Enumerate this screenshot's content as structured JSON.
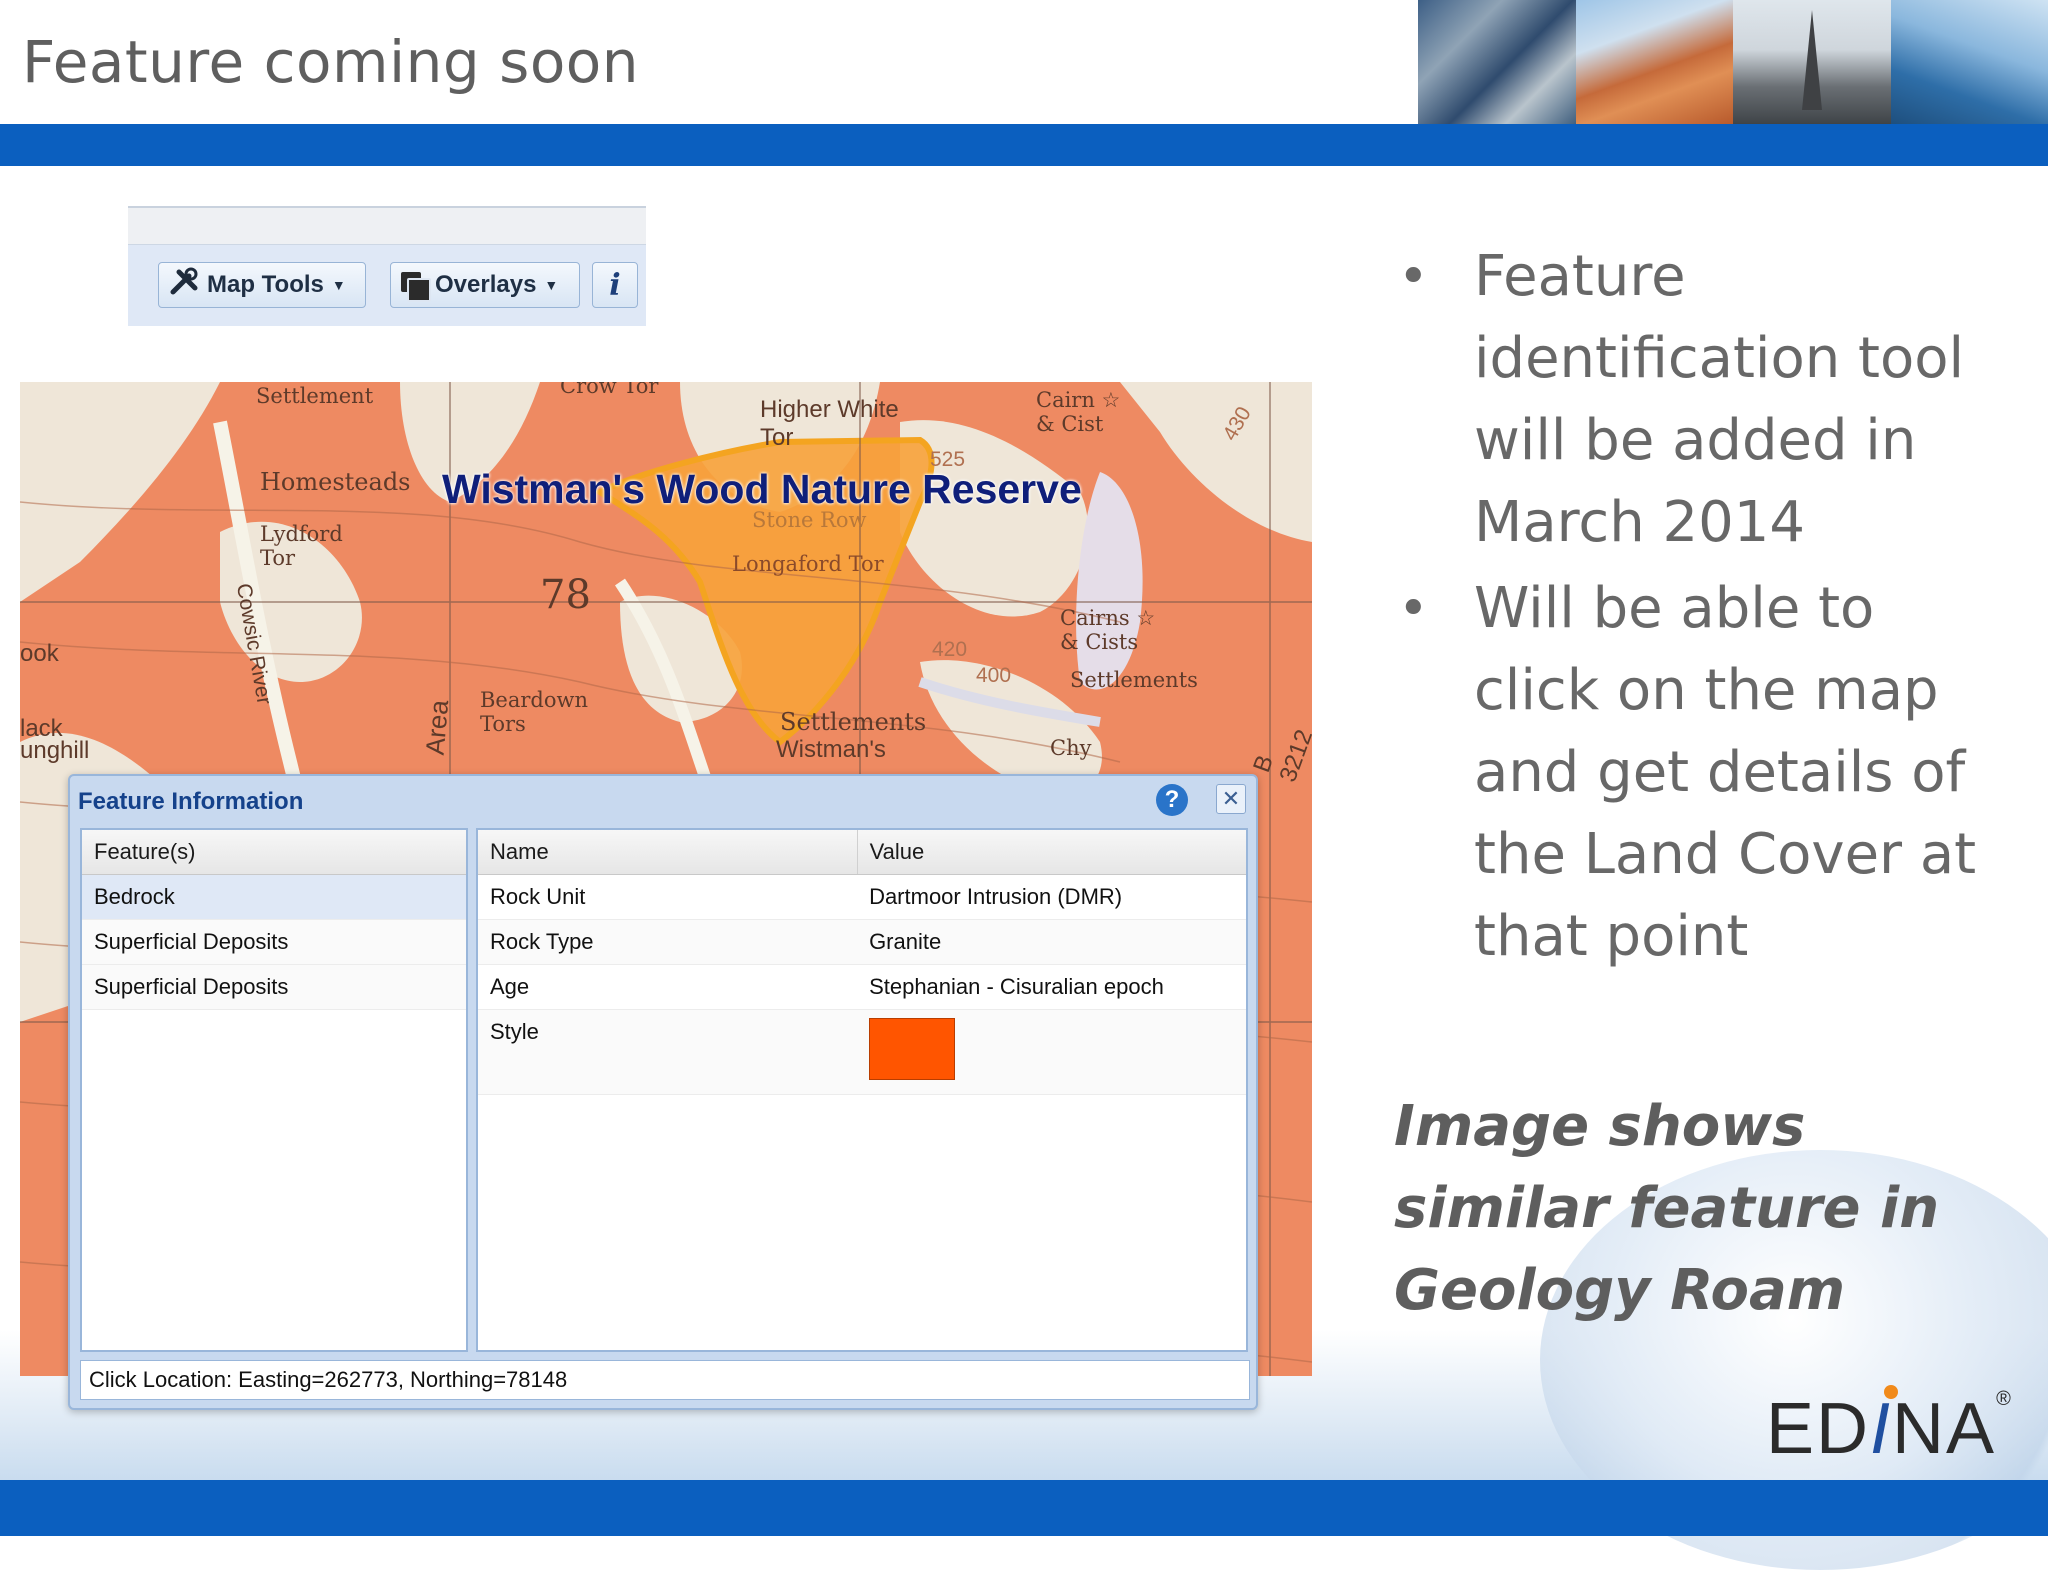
{
  "header": {
    "title": "Feature coming soon"
  },
  "toolbar": {
    "map_tools_label": "Map Tools",
    "overlays_label": "Overlays",
    "info_label": "i"
  },
  "map": {
    "reserve_title": "Wistman's Wood Nature Reserve",
    "labels": {
      "settlement": "Settlement",
      "crow_tor": "Crow Tor",
      "higher_white_tor": "Higher White Tor",
      "cairn_cist": "Cairn ☆ & Cist",
      "homesteads": "Homesteads",
      "lydford_tor": "Lydford Tor",
      "stone_row": "Stone Row",
      "longaford_tor": "Longaford Tor",
      "cairns_cists": "Cairns ☆ & Cists",
      "settlements_1": "Settlements",
      "beardown_tors": "Beardown Tors",
      "settlements_2": "Settlements",
      "wistmans": "Wistman's",
      "cowsic_river": "Cowsic River",
      "area": "Area",
      "chy": "Chy",
      "grid_78": "78",
      "ook": "ook",
      "lack_unghill": "lack unghill",
      "b3212": "B 3212",
      "contour_420": "420",
      "contour_400": "400",
      "contour_430": "430",
      "contour_525": "525"
    }
  },
  "dialog": {
    "title": "Feature Information",
    "help": "?",
    "close": "✕",
    "features_header": "Feature(s)",
    "features": [
      "Bedrock",
      "Superficial Deposits",
      "Superficial Deposits"
    ],
    "name_header": "Name",
    "value_header": "Value",
    "properties": [
      {
        "name": "Rock Unit",
        "value": "Dartmoor Intrusion (DMR)"
      },
      {
        "name": "Rock Type",
        "value": "Granite"
      },
      {
        "name": "Age",
        "value": "Stephanian - Cisuralian epoch"
      },
      {
        "name": "Style",
        "value": ""
      }
    ],
    "style_color": "#ff5500",
    "status": "Click Location: Easting=262773, Northing=78148"
  },
  "bullets": [
    "Feature identification tool will be added in March 2014",
    "Will be able to click on the map and get details of the Land Cover at that point"
  ],
  "image_note": "Image shows similar feature in Geology Roam",
  "logo": {
    "text_before": "ED",
    "text_i": "I",
    "text_after": "NA",
    "reg": "®"
  },
  "colors": {
    "brand_blue": "#0b5fbf",
    "map_orange": "#ee8a62",
    "reserve_orange": "#f7a23b"
  }
}
